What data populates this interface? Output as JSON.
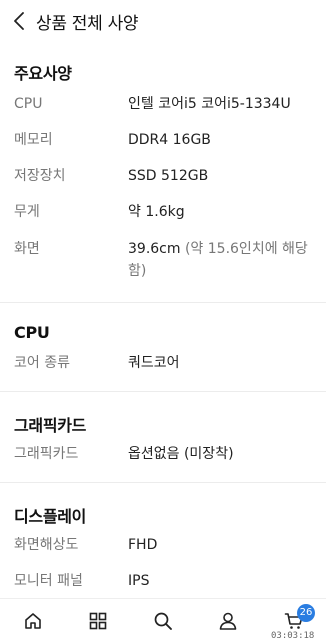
{
  "header": {
    "title": "상품 전체 사양"
  },
  "sections": [
    {
      "title": "주요사양",
      "rows": [
        {
          "key": "CPU",
          "value": "인텔 코어i5 코어i5-1334U"
        },
        {
          "key": "메모리",
          "value": "DDR4 16GB"
        },
        {
          "key": "저장장치",
          "value": "SSD 512GB"
        },
        {
          "key": "무게",
          "value": "약 1.6kg"
        },
        {
          "key": "화면",
          "value": "39.6cm",
          "value_sub": "(약 15.6인치에 해당함)"
        }
      ]
    },
    {
      "title": "CPU",
      "rows": [
        {
          "key": "코어 종류",
          "value": "쿼드코어"
        }
      ]
    },
    {
      "title": "그래픽카드",
      "rows": [
        {
          "key": "그래픽카드",
          "value": "옵션없음 (미장착)"
        }
      ]
    },
    {
      "title": "디스플레이",
      "rows": [
        {
          "key": "화면해상도",
          "value": "FHD"
        },
        {
          "key": "모니터 패널",
          "value": "IPS"
        }
      ]
    }
  ],
  "bottom_nav": {
    "items": [
      "home-icon",
      "grid-icon",
      "search-icon",
      "user-icon",
      "cart-icon"
    ],
    "cart_badge": "26"
  },
  "status": {
    "time": "03:03:18"
  }
}
